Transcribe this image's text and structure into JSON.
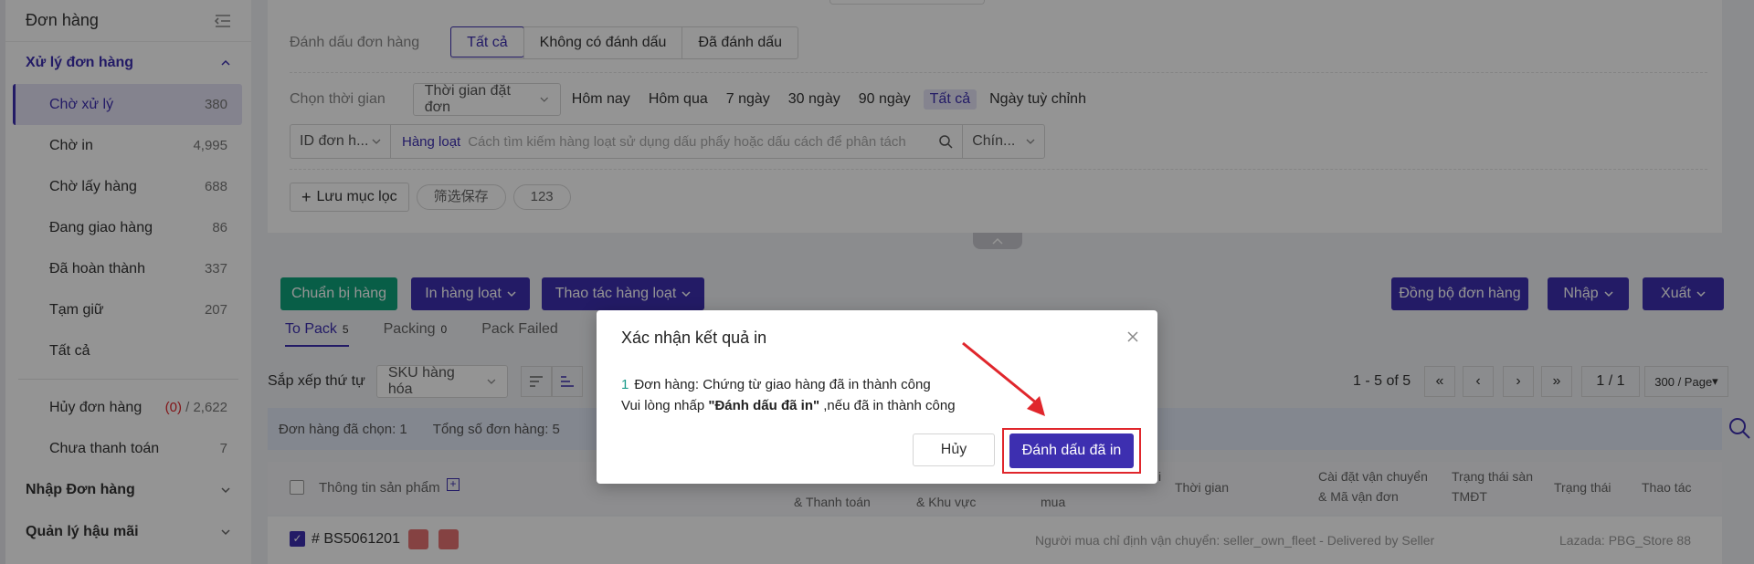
{
  "sidebar": {
    "header": "Đơn hàng",
    "group1": "Xử lý đơn hàng",
    "items": [
      {
        "label": "Chờ xử lý",
        "count": "380"
      },
      {
        "label": "Chờ in",
        "count": "4,995"
      },
      {
        "label": "Chờ lấy hàng",
        "count": "688"
      },
      {
        "label": "Đang giao hàng",
        "count": "86"
      },
      {
        "label": "Đã hoàn thành",
        "count": "337"
      },
      {
        "label": "Tạm giữ",
        "count": "207"
      },
      {
        "label": "Tất cả",
        "count": ""
      }
    ],
    "cancel": {
      "label": "Hủy đơn hàng",
      "red": "(0)",
      "total": "/ 2,622"
    },
    "unpaid": {
      "label": "Chưa thanh toán",
      "count": "7"
    },
    "group2": "Nhập Đơn hàng",
    "group3": "Quản lý hậu mãi"
  },
  "filters": {
    "mark_label": "Đánh dấu đơn hàng",
    "mark_options": [
      "Tất cả",
      "Không có đánh dấu",
      "Đã đánh dấu"
    ],
    "time_label": "Chọn thời gian",
    "time_select": "Thời gian đặt đơn",
    "time_chips": [
      "Hôm nay",
      "Hôm qua",
      "7 ngày",
      "30 ngày",
      "90 ngày",
      "Tất cả",
      "Ngày tuỳ chỉnh"
    ],
    "id_select": "ID đơn h...",
    "batch_label": "Hàng loạt",
    "search_placeholder": "Cách tìm kiếm hàng loạt sử dụng dấu phẩy hoặc dấu cách để phân tách",
    "exact_select": "Chín...",
    "save_filter": "Lưu mục lọc",
    "saved_chips": [
      "筛选保存",
      "123"
    ]
  },
  "actions": {
    "prepare": "Chuẩn bị hàng",
    "print_batch": "In hàng loạt",
    "batch_ops": "Thao tác hàng loạt",
    "sync": "Đồng bộ đơn hàng",
    "import": "Nhập",
    "export": "Xuất"
  },
  "tabs": [
    {
      "label": "To Pack",
      "count": "5"
    },
    {
      "label": "Packing",
      "count": "0"
    },
    {
      "label": "Pack Failed",
      "count": ""
    }
  ],
  "sort": {
    "label": "Sắp xếp thứ tự",
    "select": "SKU hàng hóa",
    "range": "1 - 5 of 5",
    "page": "1 / 1",
    "per_page": "300 / Page"
  },
  "info": {
    "selected": "Đơn hàng đã chọn: 1",
    "total": "Tổng số đơn hàng: 5"
  },
  "table": {
    "headers": {
      "product": "Thông tin sản phẩm",
      "payment": "& Thanh toán",
      "region": "& Khu vực",
      "buyer_tail": "mua",
      "buyer_top": "i",
      "time": "Thời gian",
      "shipping1": "Cài đặt vận chuyển",
      "shipping2": "& Mã vận đơn",
      "status1": "Trạng thái sàn",
      "status2": "TMĐT",
      "state": "Trạng thái",
      "action": "Thao tác"
    },
    "row": {
      "id": "# BS5061201",
      "shipping_note": "Người mua chỉ định vận chuyển: seller_own_fleet - Delivered by Seller",
      "store": "Lazada: PBG_Store 88"
    }
  },
  "dialog": {
    "title": "Xác nhận kết quả in",
    "line1_num": "1",
    "line1_text": "Đơn hàng: Chứng từ giao hàng đã in thành công",
    "line2_pre": "Vui lòng nhấp ",
    "line2_bold": "\"Đánh dấu đã in\"",
    "line2_post": " ,nếu đã in thành công",
    "cancel": "Hủy",
    "confirm": "Đánh dấu đã in"
  },
  "colors": {
    "primary": "#3d2fb0",
    "green": "#0fa37a",
    "highlight": "#e0262c"
  }
}
